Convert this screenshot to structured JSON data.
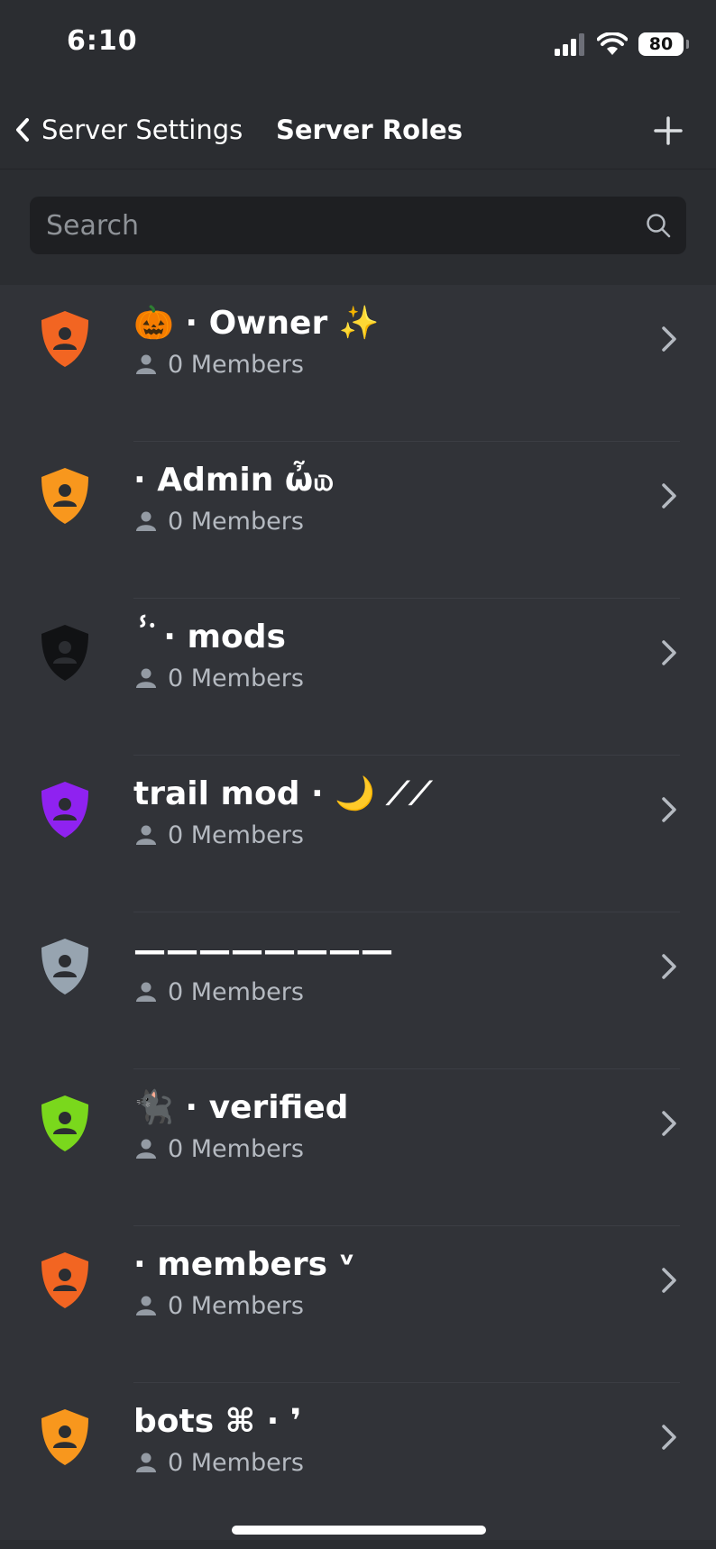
{
  "status_bar": {
    "time": "6:10",
    "battery": "80"
  },
  "nav": {
    "back_label": "Server Settings",
    "title": "Server Roles"
  },
  "search": {
    "placeholder": "Search",
    "value": ""
  },
  "roles": [
    {
      "name": "🎃 · Owner ✨",
      "members": "0 Members",
      "color": "#f26522"
    },
    {
      "name": " · Admin ὦ௰",
      "members": "0 Members",
      "color": "#f8971d"
    },
    {
      "name": "ⸯ̇ · mods",
      "members": "0 Members",
      "color": "#111214"
    },
    {
      "name": "trail mod · 🌙 ⟋⟋",
      "members": "0 Members",
      "color": "#8f22f0"
    },
    {
      "name": "————————",
      "members": "0 Members",
      "color": "#97a4b0"
    },
    {
      "name": "🐈‍⬛ · verified",
      "members": "0 Members",
      "color": "#7ad81c"
    },
    {
      "name": " · members ᵛ",
      "members": "0 Members",
      "color": "#f26522"
    },
    {
      "name": "bots ⌘ · ❜",
      "members": "0 Members",
      "color": "#f8971d"
    }
  ],
  "icons": {
    "back": "chevron-left-icon",
    "add": "plus-icon",
    "search": "search-icon",
    "role": "shield-person-icon",
    "members": "person-icon",
    "row": "chevron-right-icon"
  }
}
